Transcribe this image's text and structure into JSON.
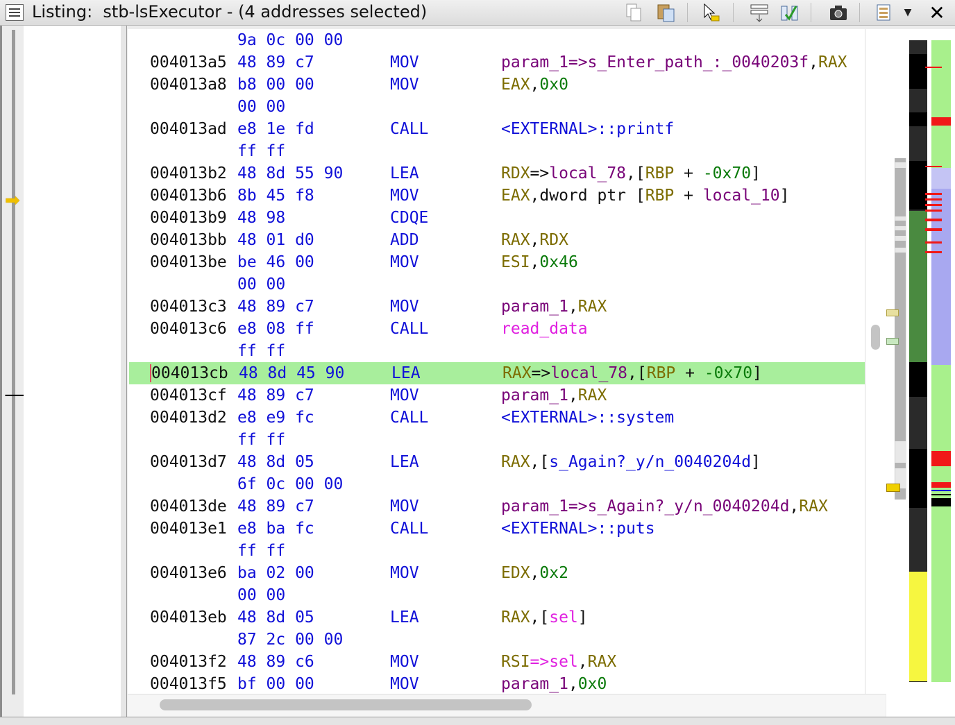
{
  "window": {
    "title": "Listing:  stb-lsExecutor - (4 addresses selected)",
    "toolbar_icons": [
      "copy-icon",
      "paste-icon",
      "cursor-select-icon",
      "field-editor-icon",
      "diff-icon",
      "snapshot-icon",
      "listing-options-icon",
      "dropdown-arrow-icon",
      "close-icon"
    ]
  },
  "colors": {
    "highlight": "#a8ee9c",
    "address": "#111111",
    "bytes": "#1010d8",
    "mnemonic": "#1010d8",
    "register": "#7c6c00",
    "local_var": "#780478",
    "number": "#0a7a0a",
    "function": "#e020e0"
  },
  "listing": {
    "rows": [
      {
        "addr": "",
        "bytes": "9a 0c 00 00",
        "mnem": "",
        "ops": []
      },
      {
        "addr": "004013a5",
        "bytes": "48 89 c7",
        "mnem": "MOV",
        "ops": [
          {
            "t": "param_1=>s_Enter_path_:_0040203f",
            "c": "loc"
          },
          {
            "t": ",",
            "c": "pun"
          },
          {
            "t": "RAX",
            "c": "reg"
          }
        ]
      },
      {
        "addr": "004013a8",
        "bytes": "b8 00 00",
        "mnem": "MOV",
        "ops": [
          {
            "t": "EAX",
            "c": "reg"
          },
          {
            "t": ",",
            "c": "pun"
          },
          {
            "t": "0x0",
            "c": "num"
          }
        ]
      },
      {
        "addr": "",
        "bytes": "00 00",
        "mnem": "",
        "ops": []
      },
      {
        "addr": "004013ad",
        "bytes": "e8 1e fd",
        "mnem": "CALL",
        "ops": [
          {
            "t": "<EXTERNAL>::printf",
            "c": "ext"
          }
        ]
      },
      {
        "addr": "",
        "bytes": "ff ff",
        "mnem": "",
        "ops": []
      },
      {
        "addr": "004013b2",
        "bytes": "48 8d 55 90",
        "mnem": "LEA",
        "ops": [
          {
            "t": "RDX",
            "c": "reg"
          },
          {
            "t": "=>",
            "c": "pun"
          },
          {
            "t": "local_78",
            "c": "loc"
          },
          {
            "t": ",[",
            "c": "pun"
          },
          {
            "t": "RBP",
            "c": "reg"
          },
          {
            "t": " + ",
            "c": "pun"
          },
          {
            "t": "-0x70",
            "c": "num"
          },
          {
            "t": "]",
            "c": "pun"
          }
        ]
      },
      {
        "addr": "004013b6",
        "bytes": "8b 45 f8",
        "mnem": "MOV",
        "ops": [
          {
            "t": "EAX",
            "c": "reg"
          },
          {
            "t": ",dword ptr [",
            "c": "pun"
          },
          {
            "t": "RBP",
            "c": "reg"
          },
          {
            "t": " + ",
            "c": "pun"
          },
          {
            "t": "local_10",
            "c": "loc"
          },
          {
            "t": "]",
            "c": "pun"
          }
        ]
      },
      {
        "addr": "004013b9",
        "bytes": "48 98",
        "mnem": "CDQE",
        "ops": []
      },
      {
        "addr": "004013bb",
        "bytes": "48 01 d0",
        "mnem": "ADD",
        "ops": [
          {
            "t": "RAX",
            "c": "reg"
          },
          {
            "t": ",",
            "c": "pun"
          },
          {
            "t": "RDX",
            "c": "reg"
          }
        ]
      },
      {
        "addr": "004013be",
        "bytes": "be 46 00",
        "mnem": "MOV",
        "ops": [
          {
            "t": "ESI",
            "c": "reg"
          },
          {
            "t": ",",
            "c": "pun"
          },
          {
            "t": "0x46",
            "c": "num"
          }
        ]
      },
      {
        "addr": "",
        "bytes": "00 00",
        "mnem": "",
        "ops": []
      },
      {
        "addr": "004013c3",
        "bytes": "48 89 c7",
        "mnem": "MOV",
        "ops": [
          {
            "t": "param_1",
            "c": "loc"
          },
          {
            "t": ",",
            "c": "pun"
          },
          {
            "t": "RAX",
            "c": "reg"
          }
        ]
      },
      {
        "addr": "004013c6",
        "bytes": "e8 08 ff",
        "mnem": "CALL",
        "ops": [
          {
            "t": "read_data",
            "c": "fn"
          }
        ]
      },
      {
        "addr": "",
        "bytes": "ff ff",
        "mnem": "",
        "ops": []
      },
      {
        "addr": "004013cb",
        "bytes": "48 8d 45 90",
        "mnem": "LEA",
        "highlight": true,
        "ops": [
          {
            "t": "RAX",
            "c": "reg"
          },
          {
            "t": "=>",
            "c": "pun"
          },
          {
            "t": "local_78",
            "c": "loc"
          },
          {
            "t": ",[",
            "c": "pun"
          },
          {
            "t": "RBP",
            "c": "reg"
          },
          {
            "t": " + ",
            "c": "pun"
          },
          {
            "t": "-0x70",
            "c": "num"
          },
          {
            "t": "]",
            "c": "pun"
          }
        ]
      },
      {
        "addr": "004013cf",
        "bytes": "48 89 c7",
        "mnem": "MOV",
        "ops": [
          {
            "t": "param_1",
            "c": "loc"
          },
          {
            "t": ",",
            "c": "pun"
          },
          {
            "t": "RAX",
            "c": "reg"
          }
        ]
      },
      {
        "addr": "004013d2",
        "bytes": "e8 e9 fc",
        "mnem": "CALL",
        "ops": [
          {
            "t": "<EXTERNAL>::system",
            "c": "ext"
          }
        ]
      },
      {
        "addr": "",
        "bytes": "ff ff",
        "mnem": "",
        "ops": []
      },
      {
        "addr": "004013d7",
        "bytes": "48 8d 05",
        "mnem": "LEA",
        "ops": [
          {
            "t": "RAX",
            "c": "reg"
          },
          {
            "t": ",[",
            "c": "pun"
          },
          {
            "t": "s_Again?_y/n_0040204d",
            "c": "str"
          },
          {
            "t": "]",
            "c": "pun"
          }
        ]
      },
      {
        "addr": "",
        "bytes": "6f 0c 00 00",
        "mnem": "",
        "ops": []
      },
      {
        "addr": "004013de",
        "bytes": "48 89 c7",
        "mnem": "MOV",
        "ops": [
          {
            "t": "param_1=>s_Again?_y/n_0040204d",
            "c": "loc"
          },
          {
            "t": ",",
            "c": "pun"
          },
          {
            "t": "RAX",
            "c": "reg"
          }
        ]
      },
      {
        "addr": "004013e1",
        "bytes": "e8 ba fc",
        "mnem": "CALL",
        "ops": [
          {
            "t": "<EXTERNAL>::puts",
            "c": "ext"
          }
        ]
      },
      {
        "addr": "",
        "bytes": "ff ff",
        "mnem": "",
        "ops": []
      },
      {
        "addr": "004013e6",
        "bytes": "ba 02 00",
        "mnem": "MOV",
        "ops": [
          {
            "t": "EDX",
            "c": "reg"
          },
          {
            "t": ",",
            "c": "pun"
          },
          {
            "t": "0x2",
            "c": "num"
          }
        ]
      },
      {
        "addr": "",
        "bytes": "00 00",
        "mnem": "",
        "ops": []
      },
      {
        "addr": "004013eb",
        "bytes": "48 8d 05",
        "mnem": "LEA",
        "ops": [
          {
            "t": "RAX",
            "c": "reg"
          },
          {
            "t": ",[",
            "c": "pun"
          },
          {
            "t": "sel",
            "c": "fn"
          },
          {
            "t": "]",
            "c": "pun"
          }
        ]
      },
      {
        "addr": "",
        "bytes": "87 2c 00 00",
        "mnem": "",
        "ops": []
      },
      {
        "addr": "004013f2",
        "bytes": "48 89 c6",
        "mnem": "MOV",
        "ops": [
          {
            "t": "RSI",
            "c": "reg"
          },
          {
            "t": "=>",
            "c": "fn"
          },
          {
            "t": "sel",
            "c": "fn"
          },
          {
            "t": ",",
            "c": "pun"
          },
          {
            "t": "RAX",
            "c": "reg"
          }
        ]
      },
      {
        "addr": "004013f5",
        "bytes": "bf 00 00",
        "mnem": "MOV",
        "ops": [
          {
            "t": "param_1",
            "c": "loc"
          },
          {
            "t": ",",
            "c": "pun"
          },
          {
            "t": "0x0",
            "c": "num"
          }
        ]
      }
    ]
  }
}
